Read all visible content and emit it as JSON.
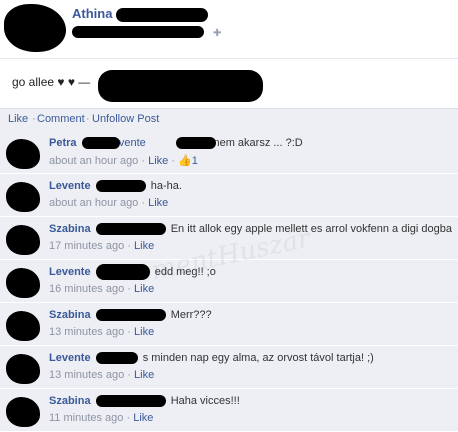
{
  "post": {
    "author": "Athina",
    "status": "go allee ♥ ♥ —",
    "people_icon": "people-icon"
  },
  "actions": {
    "like": "Like",
    "comment": "Comment",
    "unfollow": "Unfollow Post",
    "separator": "·"
  },
  "comments": [
    {
      "name": "Petra",
      "prefix": "Levente",
      "text": "ebbe nem akarsz ... ?:D",
      "time": "about an hour ago",
      "like": "Like",
      "likes": "1"
    },
    {
      "name": "Levente",
      "prefix": "",
      "text": "ha-ha.",
      "time": "about an hour ago",
      "like": "Like",
      "likes": ""
    },
    {
      "name": "Szabina",
      "prefix": "",
      "text": "En itt allok egy apple mellett es arrol vokfenn a digi dogba",
      "time": "17 minutes ago",
      "like": "Like",
      "likes": ""
    },
    {
      "name": "Levente",
      "prefix": "",
      "text": "edd meg!! ;o",
      "time": "16 minutes ago",
      "like": "Like",
      "likes": ""
    },
    {
      "name": "Szabina",
      "prefix": "",
      "text": "Merr???",
      "time": "13 minutes ago",
      "like": "Like",
      "likes": ""
    },
    {
      "name": "Levente",
      "prefix": "",
      "text": "s minden nap egy alma, az orvost távol tartja! ;)",
      "time": "13 minutes ago",
      "like": "Like",
      "likes": ""
    },
    {
      "name": "Szabina",
      "prefix": "",
      "text": "Haha vicces!!!",
      "time": "11 minutes ago",
      "like": "Like",
      "likes": ""
    }
  ],
  "watermark": "mentHuszár",
  "colors": {
    "link": "#3b5998",
    "comment_bg": "#edeff4",
    "meta": "#8d94a3"
  }
}
